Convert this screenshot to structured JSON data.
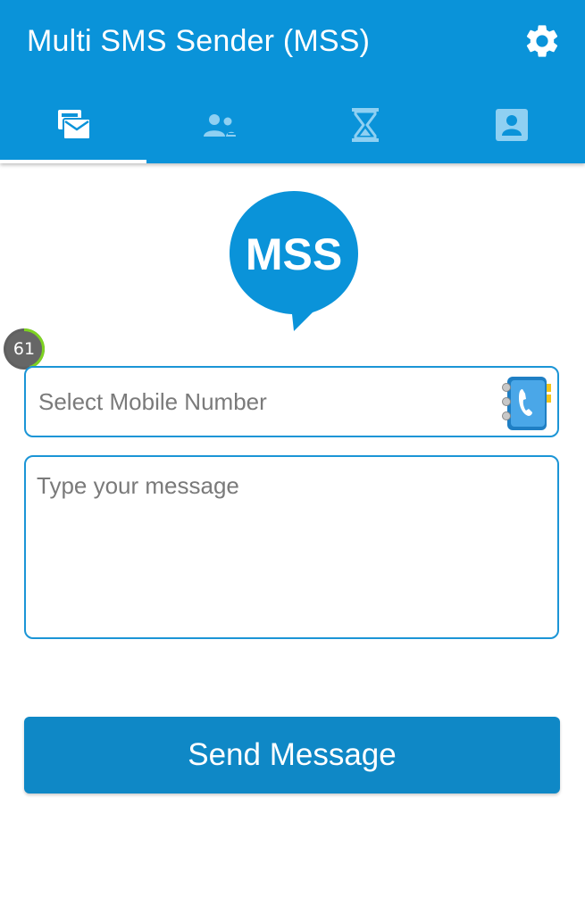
{
  "appbar": {
    "title": "Multi SMS Sender (MSS)",
    "color": "#0a93d9",
    "settings_icon": "gear-icon"
  },
  "tabs": [
    {
      "name": "compose",
      "icon": "mail-stack-icon",
      "selected": true
    },
    {
      "name": "groups",
      "icon": "people-icon",
      "selected": false
    },
    {
      "name": "scheduled",
      "icon": "hourglass-icon",
      "selected": false
    },
    {
      "name": "contacts",
      "icon": "contact-card-icon",
      "selected": false
    }
  ],
  "logo": {
    "text": "MSS",
    "color": "#0a93d9"
  },
  "counter": {
    "value": "61",
    "progress": 0.45,
    "ring_color": "#7ed321"
  },
  "form": {
    "number_placeholder": "Select Mobile Number",
    "number_value": "",
    "message_placeholder": "Type your message",
    "message_value": "",
    "contacts_icon": "phone-book-icon",
    "border_color": "#1b95d6"
  },
  "send_button": {
    "label": "Send Message",
    "color": "#0f88c6"
  }
}
